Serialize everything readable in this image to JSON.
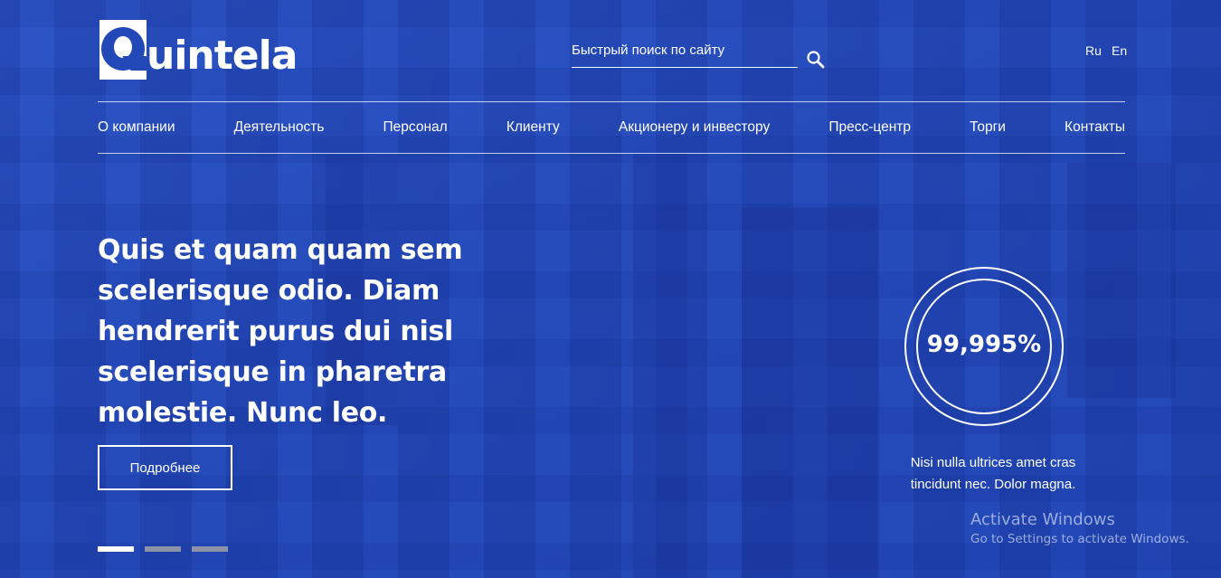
{
  "header": {
    "logo_text": "uintela",
    "search": {
      "placeholder": "Быстрый поиск по сайту"
    },
    "languages": [
      "Ru",
      "En"
    ]
  },
  "nav": {
    "items": [
      "О компании",
      "Деятельность",
      "Персонал",
      "Клиенту",
      "Акционеру и инвестору",
      "Пресс-центр",
      "Торги",
      "Контакты"
    ]
  },
  "hero": {
    "headline": "Quis et quam quam sem scelerisque odio. Diam hendrerit purus dui nisl scelerisque in pharetra molestie. Nunc leo.",
    "more_button": "Подробнее",
    "slide_count": 3,
    "active_slide": 1
  },
  "stat": {
    "value": "99,995%",
    "caption": "Nisi nulla ultrices amet cras tincidunt nec. Dolor magna."
  },
  "watermark": {
    "title": "Activate Windows",
    "subtitle": "Go to Settings to activate Windows."
  },
  "colors": {
    "background": "#2349b8",
    "text": "#ffffff",
    "dot_active": "#ffffff",
    "dot_inactive": "#8c93a8"
  }
}
